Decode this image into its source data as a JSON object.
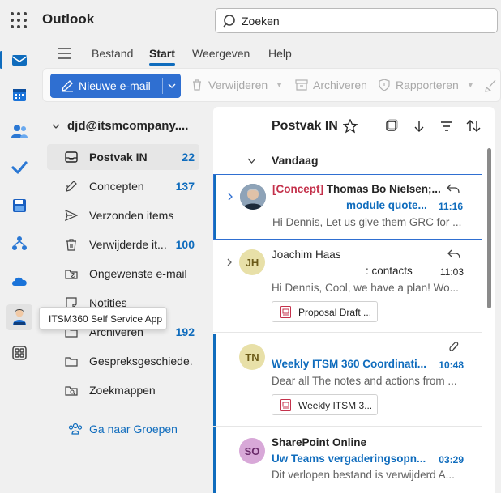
{
  "app": {
    "title": "Outlook"
  },
  "search": {
    "value": "Zoeken"
  },
  "rail": {
    "items": [
      {
        "name": "mail-icon",
        "active": true
      },
      {
        "name": "calendar-icon"
      },
      {
        "name": "people-icon"
      },
      {
        "name": "todo-icon"
      },
      {
        "name": "save-icon"
      },
      {
        "name": "org-icon"
      },
      {
        "name": "onedrive-icon"
      },
      {
        "name": "itsm-app-icon"
      },
      {
        "name": "more-apps-icon"
      }
    ]
  },
  "ribbon_tabs": [
    {
      "label": "Bestand"
    },
    {
      "label": "Start",
      "active": true
    },
    {
      "label": "Weergeven"
    },
    {
      "label": "Help"
    }
  ],
  "toolbar": {
    "new_mail": "Nieuwe e-mail",
    "delete": "Verwijderen",
    "archive": "Archiveren",
    "report": "Rapporteren"
  },
  "account": "djd@itsmcompany....",
  "folders": [
    {
      "name": "Postvak IN",
      "count": "22",
      "selected": true,
      "icon": "inbox-icon"
    },
    {
      "name": "Concepten",
      "count": "137",
      "icon": "draft-icon"
    },
    {
      "name": "Verzonden items",
      "count": "",
      "icon": "send-icon"
    },
    {
      "name": "Verwijderde it...",
      "count": "100",
      "icon": "trash-icon"
    },
    {
      "name": "Ongewenste e-mail",
      "count": "",
      "icon": "junk-icon"
    },
    {
      "name": "Notities",
      "count": "",
      "icon": "notes-icon"
    },
    {
      "name": "Archiveren",
      "count": "192",
      "icon": "archive-icon"
    },
    {
      "name": "Gespreksgeschiede...",
      "count": "",
      "icon": "folder-icon"
    },
    {
      "name": "Zoekmappen",
      "count": "",
      "icon": "search-folder-icon"
    }
  ],
  "groups_link": "Ga naar Groepen",
  "tooltip": "ITSM360 Self Service App",
  "list": {
    "title": "Postvak IN",
    "group_label": "Vandaag",
    "messages": [
      {
        "tag": "[Concept]",
        "from": "Thomas Bo Nielsen;...",
        "subject": "module quote...",
        "time": "11:16",
        "preview": "Hi Dennis, Let us give them GRC for ...",
        "avatar_type": "photo"
      },
      {
        "from": "Joachim Haas",
        "subject": ": contacts",
        "time": "11:03",
        "preview": "Hi Dennis, Cool, we have a plan! Wo...",
        "initials": "JH",
        "avatar_color": "#e8e0a8",
        "attachment": "Proposal Draft ..."
      },
      {
        "from": "",
        "subject": "Weekly ITSM 360 Coordinati...",
        "time": "10:48",
        "preview": "Dear all The notes and actions from ...",
        "initials": "TN",
        "avatar_color": "#e8e0a8",
        "attachment": "Weekly ITSM 3..."
      },
      {
        "from": "SharePoint Online",
        "subject": "Uw Teams vergaderingsopn...",
        "time": "03:29",
        "preview": "Dit verlopen bestand is verwijderd A...",
        "initials": "SO",
        "avatar_color": "#d8a8d8"
      }
    ]
  },
  "colors": {
    "accent": "#0f6cbd",
    "button": "#2f6fd1"
  }
}
